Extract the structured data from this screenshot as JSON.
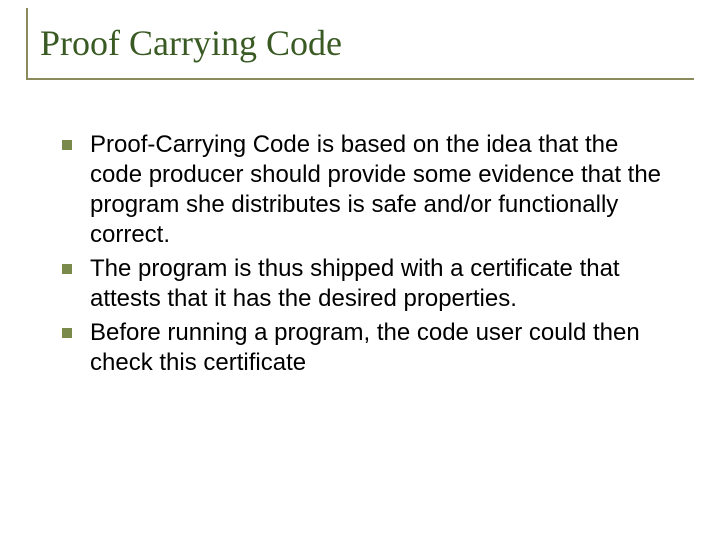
{
  "slide": {
    "title": "Proof Carrying Code",
    "bullets": [
      "Proof-Carrying Code is based on the idea that the code producer should provide some evidence that the program she distributes is safe and/or functionally correct.",
      "The program is thus shipped with a certificate that attests that it has the desired properties.",
      "Before running a program, the code user could then check this certificate"
    ]
  }
}
